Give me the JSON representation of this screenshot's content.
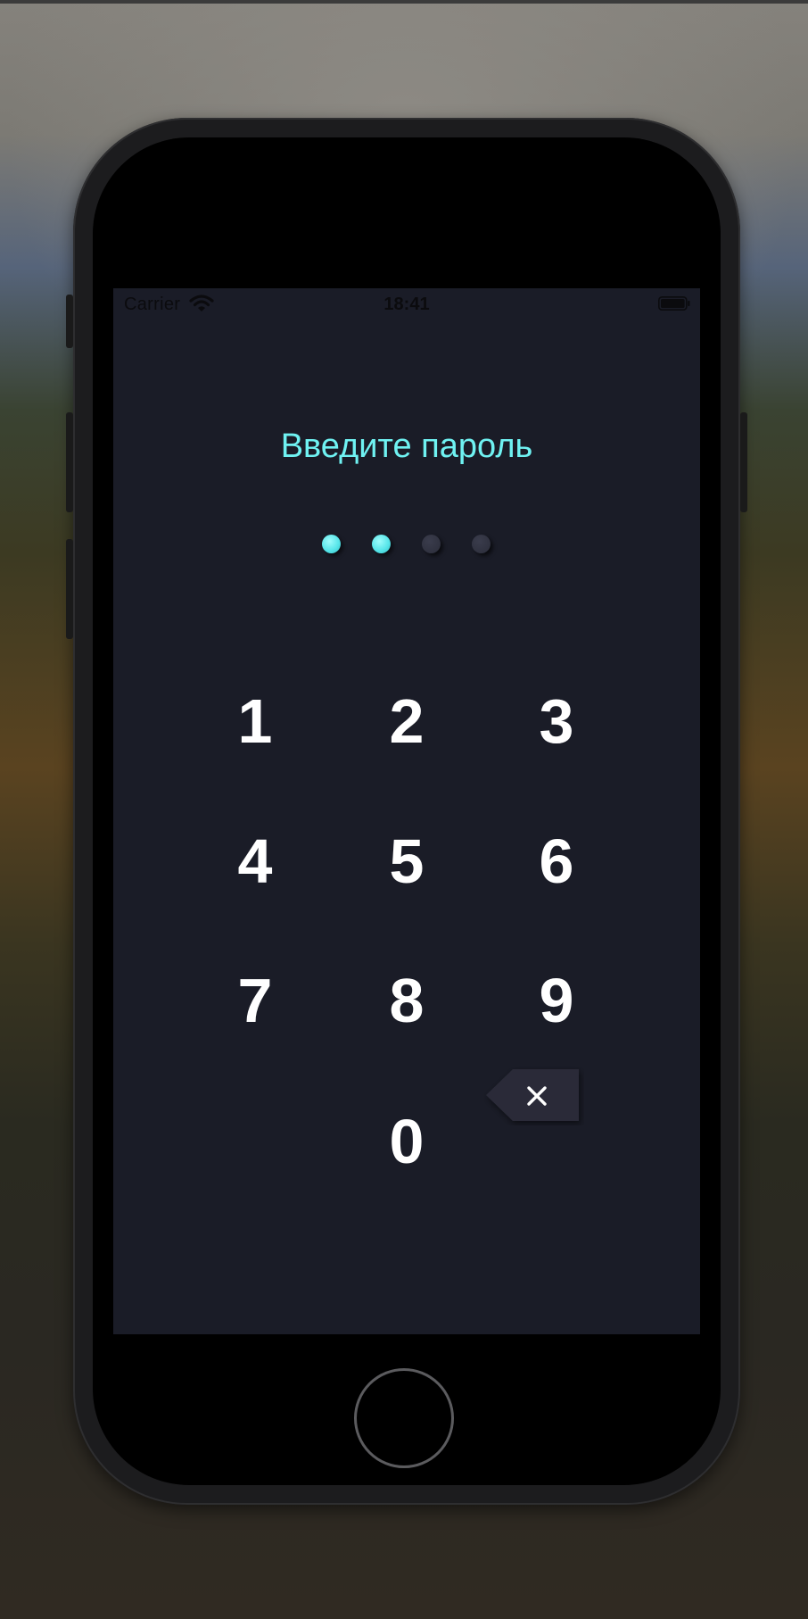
{
  "status_bar": {
    "carrier": "Carrier",
    "time": "18:41",
    "wifi_icon": "wifi-icon",
    "battery_icon": "battery-icon"
  },
  "passcode": {
    "title": "Введите пароль",
    "total_digits": 4,
    "entered_digits": 2,
    "filled_color": "#58e6ea",
    "empty_color": "#2b2d3a"
  },
  "keypad": {
    "keys": [
      "1",
      "2",
      "3",
      "4",
      "5",
      "6",
      "7",
      "8",
      "9",
      "0"
    ],
    "delete_icon": "backspace-x-icon"
  },
  "colors": {
    "screen_background": "#1a1c27",
    "accent": "#6ff2f2",
    "key_text": "#ffffff"
  }
}
